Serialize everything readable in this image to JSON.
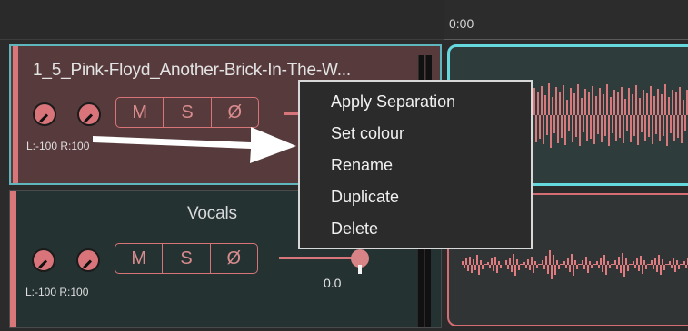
{
  "timeline": {
    "time_start": "0:00"
  },
  "tracks": [
    {
      "name": "1_5_Pink-Floyd_Another-Brick-In-The-W...",
      "pan": "L:-100 R:100",
      "buttons": {
        "mute": "M",
        "solo": "S",
        "phase": "Ø"
      },
      "selected": true,
      "color": "#d8777a"
    },
    {
      "name": "Vocals",
      "pan": "L:-100 R:100",
      "buttons": {
        "mute": "M",
        "solo": "S",
        "phase": "Ø"
      },
      "gain": "0.0",
      "color": "#d8777a"
    }
  ],
  "context_menu": {
    "items": [
      {
        "label": "Apply Separation"
      },
      {
        "label": "Set colour"
      },
      {
        "label": "Rename"
      },
      {
        "label": "Duplicate"
      },
      {
        "label": "Delete"
      }
    ]
  },
  "colors": {
    "accent_cyan": "#66d9de",
    "accent_pink": "#d8777a",
    "waveform": "#e07b7f"
  }
}
